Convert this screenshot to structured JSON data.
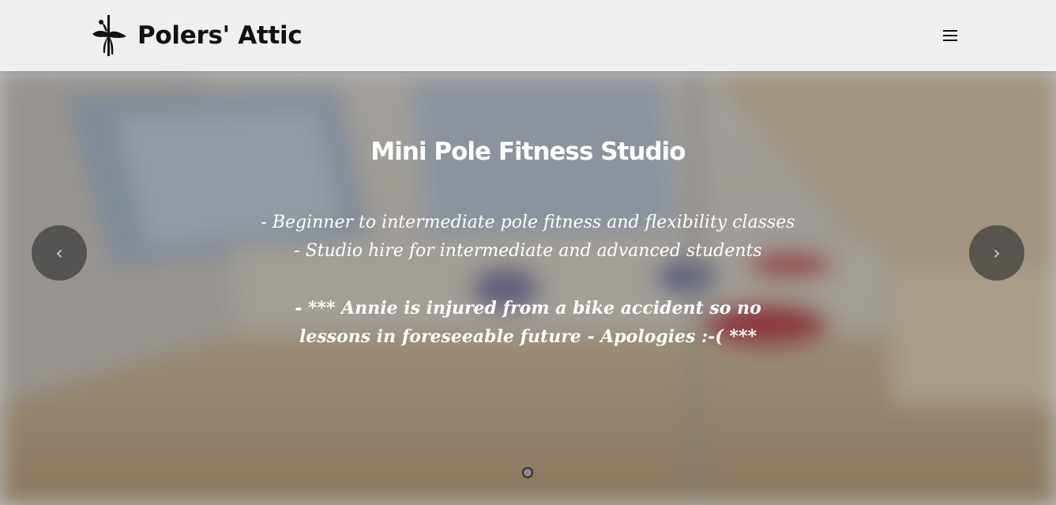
{
  "header": {
    "brand_name": "Polers' Attic",
    "logo_icon": "pole-dancer-logo-icon",
    "menu_icon": "hamburger-menu-icon",
    "background_color": "#efefef"
  },
  "hero": {
    "title": "Mini Pole Fitness Studio",
    "lines": [
      "- Beginner to intermediate pole fitness and flexibility classes",
      "- Studio hire for intermediate and advanced students"
    ],
    "notice": "- *** Annie is injured from a bike accident so no lessons in foreseeable future - Apologies :-( ***",
    "prev_label": "‹",
    "next_label": "›",
    "prev_icon": "chevron-left-icon",
    "next_icon": "chevron-right-icon",
    "slide_count": 1,
    "active_slide": 1
  }
}
